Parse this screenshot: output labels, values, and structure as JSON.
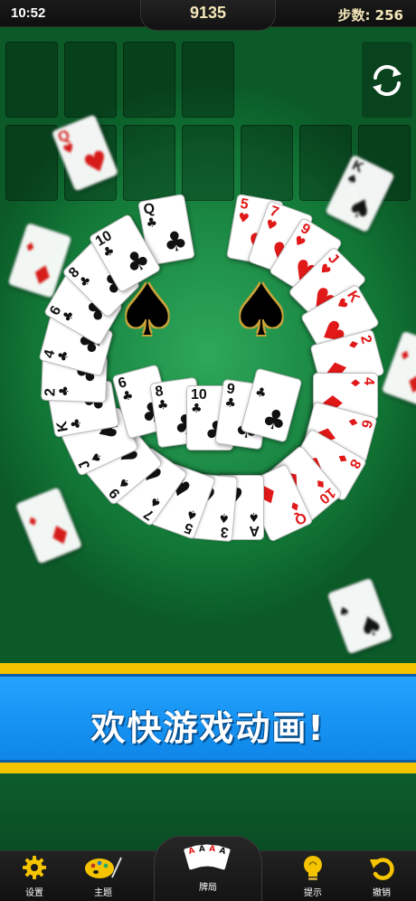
{
  "status": {
    "time": "10:52",
    "score": "9135",
    "steps": "步数: 256"
  },
  "banner": {
    "text": "欢快游戏动画!"
  },
  "nav": [
    {
      "label": "设置",
      "icon": "gear-icon"
    },
    {
      "label": "主题",
      "icon": "palette-icon"
    },
    {
      "label": "牌局",
      "icon": "cards-icon"
    },
    {
      "label": "提示",
      "icon": "lightbulb-icon"
    },
    {
      "label": "撤销",
      "icon": "undo-icon"
    }
  ],
  "nav_cards": [
    "A",
    "A",
    "A",
    "A"
  ],
  "colors": {
    "felt": "#1e8e48",
    "banner_blue": "#1696f2",
    "banner_yellow": "#f5c400",
    "accent_gold": "#f3e6b8"
  },
  "cards": [
    {
      "rank": "Q",
      "suit": "♥"
    },
    {
      "rank": "",
      "suit": "♦"
    },
    {
      "rank": "K",
      "suit": "♠"
    },
    {
      "rank": "",
      "suit": "♦"
    },
    {
      "rank": "",
      "suit": "♦"
    },
    {
      "rank": "",
      "suit": "♠"
    },
    {
      "rank": "Q",
      "suit": "♣"
    },
    {
      "rank": "5",
      "suit": "♥"
    },
    {
      "rank": "7",
      "suit": "♥"
    },
    {
      "rank": "9",
      "suit": "♥"
    },
    {
      "rank": "J",
      "suit": "♥"
    },
    {
      "rank": "K",
      "suit": "♥"
    },
    {
      "rank": "2",
      "suit": "♦"
    },
    {
      "rank": "4",
      "suit": "♦"
    },
    {
      "rank": "6",
      "suit": "♦"
    },
    {
      "rank": "8",
      "suit": "♦"
    },
    {
      "rank": "10",
      "suit": "♦"
    },
    {
      "rank": "Q",
      "suit": "♦"
    },
    {
      "rank": "A",
      "suit": "♠"
    },
    {
      "rank": "3",
      "suit": "♠"
    },
    {
      "rank": "5",
      "suit": "♠"
    },
    {
      "rank": "7",
      "suit": "♠"
    },
    {
      "rank": "9",
      "suit": "♠"
    },
    {
      "rank": "J",
      "suit": "♠"
    },
    {
      "rank": "K",
      "suit": "♣"
    },
    {
      "rank": "2",
      "suit": "♣"
    },
    {
      "rank": "4",
      "suit": "♣"
    },
    {
      "rank": "6",
      "suit": "♣"
    },
    {
      "rank": "8",
      "suit": "♣"
    },
    {
      "rank": "10",
      "suit": "♣"
    },
    {
      "rank": "6",
      "suit": "♣"
    },
    {
      "rank": "8",
      "suit": "♣"
    },
    {
      "rank": "10",
      "suit": "♣"
    },
    {
      "rank": "9",
      "suit": "♣"
    },
    {
      "rank": "",
      "suit": "♣"
    }
  ]
}
